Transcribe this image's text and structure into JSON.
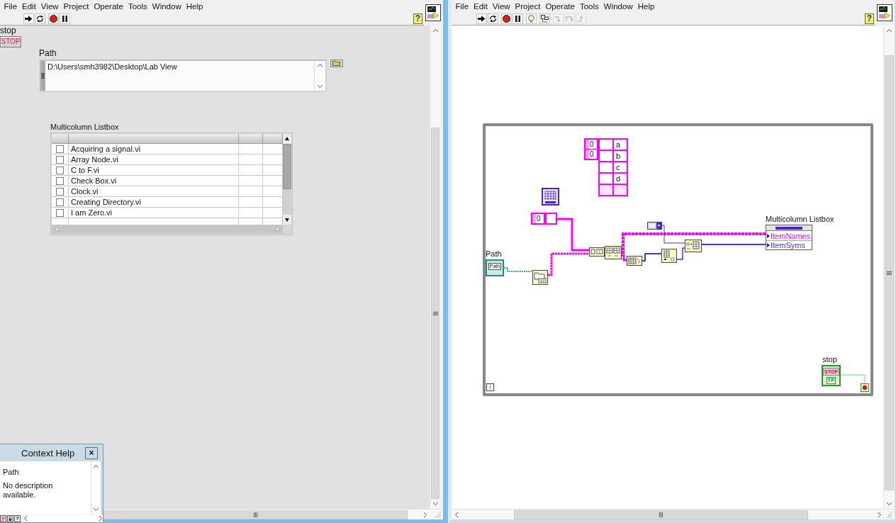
{
  "front_panel": {
    "menu": [
      "File",
      "Edit",
      "View",
      "Project",
      "Operate",
      "Tools",
      "Window",
      "Help"
    ],
    "toolbar": [
      {
        "kind": "run",
        "disabled": false
      },
      {
        "kind": "run-continuously",
        "disabled": false
      },
      {
        "kind": "abort",
        "disabled": false
      },
      {
        "kind": "pause",
        "disabled": false
      }
    ],
    "help_button": "?",
    "stop_control": {
      "label": "stop",
      "text": "STOP"
    },
    "path_control": {
      "label": "Path",
      "value": "D:\\Users\\smh3982\\Desktop\\Lab View"
    },
    "listbox": {
      "label": "Multicolumn Listbox",
      "rows": [
        {
          "checked": false,
          "name": "Acquiring a signal.vi"
        },
        {
          "checked": false,
          "name": "Array Node.vi"
        },
        {
          "checked": false,
          "name": "C to F.vi"
        },
        {
          "checked": false,
          "name": "Check Box.vi"
        },
        {
          "checked": false,
          "name": "Clock.vi"
        },
        {
          "checked": false,
          "name": "Creating Directory.vi"
        },
        {
          "checked": false,
          "name": "I am Zero.vi"
        }
      ]
    }
  },
  "block_diagram": {
    "menu": [
      "File",
      "Edit",
      "View",
      "Project",
      "Operate",
      "Tools",
      "Window",
      "Help"
    ],
    "toolbar": [
      {
        "kind": "run",
        "disabled": false
      },
      {
        "kind": "run-continuously",
        "disabled": false
      },
      {
        "kind": "abort",
        "disabled": false
      },
      {
        "kind": "pause",
        "disabled": false
      },
      {
        "kind": "highlight",
        "disabled": false
      },
      {
        "kind": "retain",
        "disabled": false
      },
      {
        "kind": "step-into",
        "disabled": true
      },
      {
        "kind": "step-over",
        "disabled": true
      },
      {
        "kind": "step-out",
        "disabled": true
      }
    ],
    "help_button": "?",
    "array_constant": {
      "indexes": [
        "0",
        "0"
      ],
      "cells": [
        "a",
        "b",
        "c",
        "d"
      ]
    },
    "index_constant": {
      "index": "0"
    },
    "path_terminal": {
      "label": "Path",
      "text": "Path"
    },
    "listbox_property_node": {
      "label": "Multicolumn Listbox",
      "properties": [
        {
          "name": "ItemNames",
          "color": "#ff00ff"
        },
        {
          "name": "ItemSyms",
          "color": "#5b2bd0"
        }
      ]
    },
    "stop_terminal": {
      "label": "stop",
      "text": "STOP",
      "type": "TF"
    },
    "iteration_terminal": "i"
  },
  "context_help": {
    "title": "Context Help",
    "close": "×",
    "heading": "Path",
    "description": "No description available.",
    "help_button": "?"
  }
}
